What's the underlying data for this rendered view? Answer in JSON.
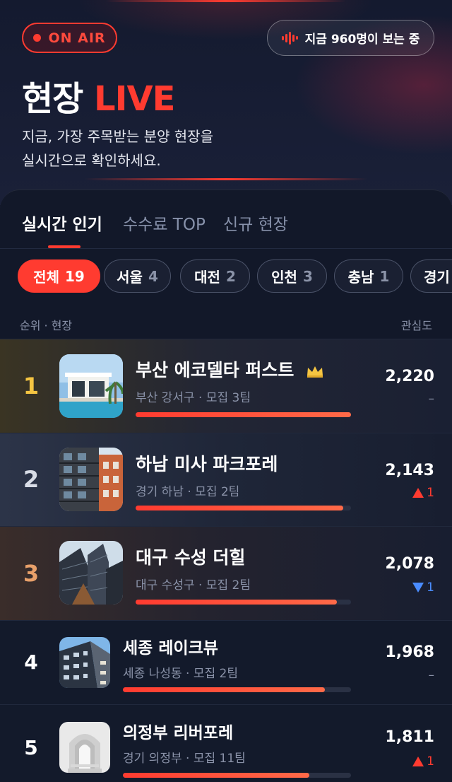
{
  "header": {
    "badge_label": "ON AIR",
    "viewers_label": "지금 960명이 보는 중",
    "title_main": "현장",
    "title_accent": "LIVE",
    "subtitle_line1": "지금, 가장 주목받는 분양 현장을",
    "subtitle_line2": "실시간으로 확인하세요."
  },
  "tabs": [
    {
      "label": "실시간 인기",
      "active": true
    },
    {
      "label": "수수료 TOP",
      "active": false
    },
    {
      "label": "신규 현장",
      "active": false
    }
  ],
  "filters": [
    {
      "label": "전체",
      "count": "19",
      "active": true
    },
    {
      "label": "서울",
      "count": "4"
    },
    {
      "label": "대전",
      "count": "2"
    },
    {
      "label": "인천",
      "count": "3"
    },
    {
      "label": "충남",
      "count": "1"
    },
    {
      "label": "경기",
      "count": ""
    }
  ],
  "list_header": {
    "left": "순위 · 현장",
    "right": "관심도"
  },
  "items": [
    {
      "rank": "1",
      "name": "부산 에코델타 퍼스트",
      "sub": "부산 강서구 · 모집 3팀",
      "score": "2,220",
      "delta": "–",
      "delta_value": "",
      "trend": "same",
      "progress": 1.0,
      "crown": true,
      "rank_color": "#f5c542"
    },
    {
      "rank": "2",
      "name": "하남 미사 파크포레",
      "sub": "경기 하남 · 모집 2팀",
      "score": "2,143",
      "delta": "",
      "delta_value": "1",
      "trend": "up",
      "progress": 0.965,
      "rank_color": "#d8dce6"
    },
    {
      "rank": "3",
      "name": "대구 수성 더힐",
      "sub": "대구 수성구 · 모집 2팀",
      "score": "2,078",
      "delta": "",
      "delta_value": "1",
      "trend": "down",
      "progress": 0.936,
      "rank_color": "#e8a06a"
    },
    {
      "rank": "4",
      "name": "세종 레이크뷰",
      "sub": "세종 나성동 · 모집 2팀",
      "score": "1,968",
      "delta": "–",
      "delta_value": "",
      "trend": "same",
      "progress": 0.886,
      "rank_color": "#ffffff"
    },
    {
      "rank": "5",
      "name": "의정부 리버포레",
      "sub": "경기 의정부 · 모집 11팀",
      "score": "1,811",
      "delta": "",
      "delta_value": "1",
      "trend": "up",
      "progress": 0.816,
      "rank_color": "#ffffff"
    }
  ],
  "colors": {
    "accent": "#ff3b30",
    "up": "#ff3b30",
    "down": "#4a8cff",
    "gold": "#f5c542"
  }
}
